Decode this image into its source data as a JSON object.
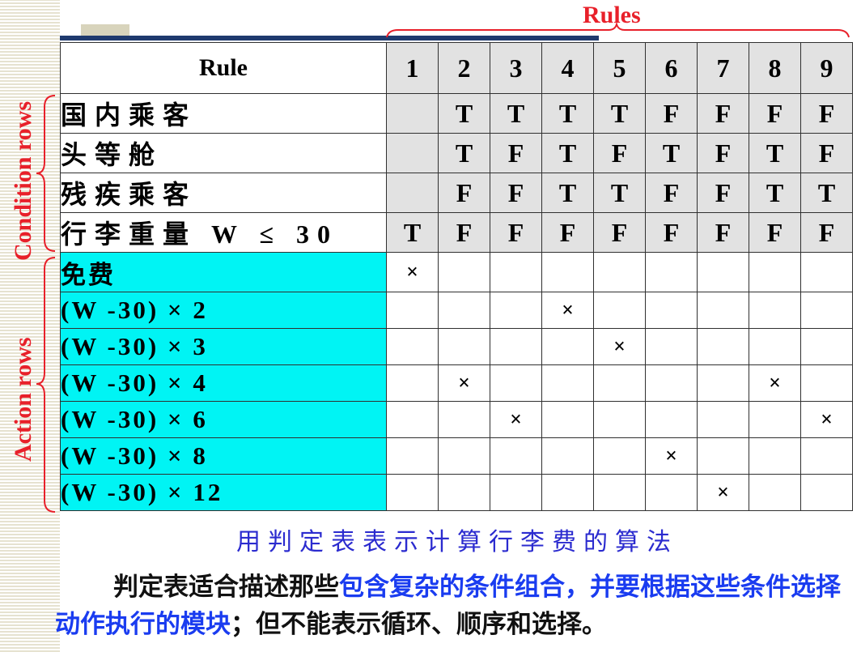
{
  "header": {
    "rules_label": "Rules",
    "rule_col_label": "Rule"
  },
  "side_labels": {
    "condition": "Condition rows",
    "action": "Action rows"
  },
  "rule_numbers": [
    "1",
    "2",
    "3",
    "4",
    "5",
    "6",
    "7",
    "8",
    "9"
  ],
  "conditions": [
    {
      "label": "国内乘客",
      "values": [
        "",
        "T",
        "T",
        "T",
        "T",
        "F",
        "F",
        "F",
        "F"
      ]
    },
    {
      "label": "头等舱",
      "values": [
        "",
        "T",
        "F",
        "T",
        "F",
        "T",
        "F",
        "T",
        "F"
      ]
    },
    {
      "label": "残疾乘客",
      "values": [
        "",
        "F",
        "F",
        "T",
        "T",
        "F",
        "F",
        "T",
        "T"
      ]
    },
    {
      "label": "行李重量 W ≤ 30",
      "values": [
        "T",
        "F",
        "F",
        "F",
        "F",
        "F",
        "F",
        "F",
        "F"
      ]
    }
  ],
  "actions": [
    {
      "label": "免费",
      "marks": [
        "×",
        "",
        "",
        "",
        "",
        "",
        "",
        "",
        ""
      ]
    },
    {
      "label": "(W -30) × 2",
      "marks": [
        "",
        "",
        "",
        "×",
        "",
        "",
        "",
        "",
        ""
      ]
    },
    {
      "label": "(W -30) × 3",
      "marks": [
        "",
        "",
        "",
        "",
        "×",
        "",
        "",
        "",
        ""
      ]
    },
    {
      "label": "(W -30) × 4",
      "marks": [
        "",
        "×",
        "",
        "",
        "",
        "",
        "",
        "×",
        ""
      ]
    },
    {
      "label": "(W -30) × 6",
      "marks": [
        "",
        "",
        "×",
        "",
        "",
        "",
        "",
        "",
        "×"
      ]
    },
    {
      "label": "(W -30) × 8",
      "marks": [
        "",
        "",
        "",
        "",
        "",
        "×",
        "",
        "",
        ""
      ]
    },
    {
      "label": "(W -30) × 12",
      "marks": [
        "",
        "",
        "",
        "",
        "",
        "",
        "×",
        "",
        ""
      ]
    }
  ],
  "caption": "用判定表表示计算行李费的算法",
  "paragraph": {
    "part1": "判定表适合描述那些",
    "part2_blue": "包含复杂的条件组合，并要根据这些条件选择动作执行的模块",
    "part3": "；但不能表示循环、顺序和选择。"
  },
  "colors": {
    "accent_red": "#e8202a",
    "action_cyan": "#00f4f4",
    "blue_text": "#1a3cf0",
    "caption_blue": "#2b2bcf"
  }
}
